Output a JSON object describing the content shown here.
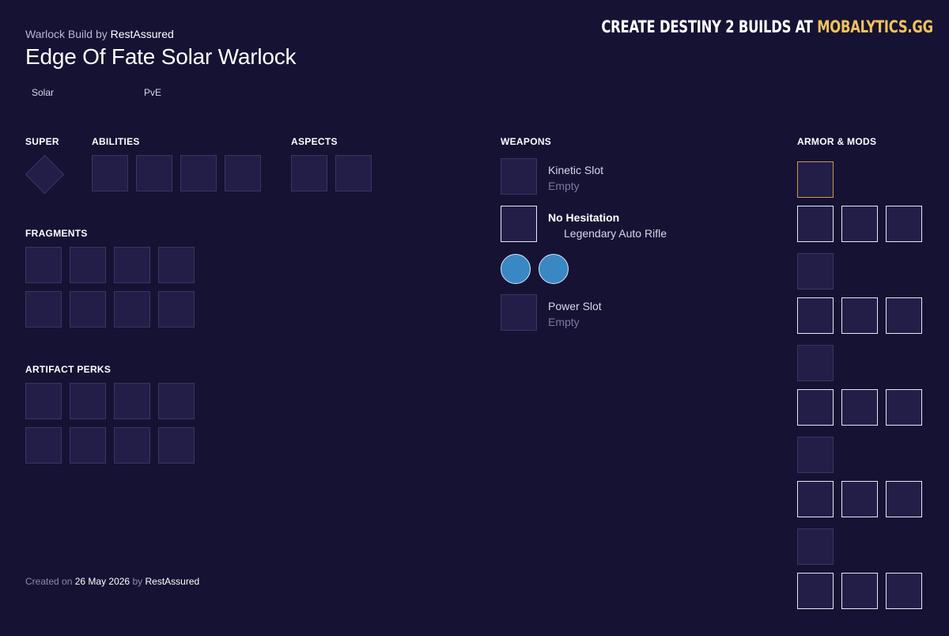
{
  "header": {
    "subtitle_prefix": "Warlock Build by",
    "author": "RestAssured",
    "title": "Edge Of Fate Solar Warlock",
    "tags": [
      "Solar",
      "PvE"
    ]
  },
  "brand": {
    "prefix": "CREATE DESTINY 2 BUILDS AT",
    "site": "MOBALYTICS.GG",
    "accent_color": "#f0c35a"
  },
  "sections": {
    "super": "SUPER",
    "abilities": "ABILITIES",
    "aspects": "ASPECTS",
    "fragments": "FRAGMENTS",
    "artifact_perks": "ARTIFACT PERKS",
    "weapons": "WEAPONS",
    "armor_mods": "ARMOR & MODS"
  },
  "weapons": {
    "kinetic": {
      "name": "Kinetic Slot",
      "sub": "Empty"
    },
    "energy": {
      "name": "No Hesitation",
      "sub": "Legendary Auto Rifle"
    },
    "power": {
      "name": "Power Slot",
      "sub": "Empty"
    }
  },
  "footer": {
    "created_on_label": "Created on",
    "date": "26 May 2026",
    "by_label": "by",
    "author": "RestAssured"
  },
  "colors": {
    "background": "#161233",
    "slot": "#231e48",
    "socket": "#3a88c3",
    "armor_exotic_border": "#c79a4c"
  }
}
